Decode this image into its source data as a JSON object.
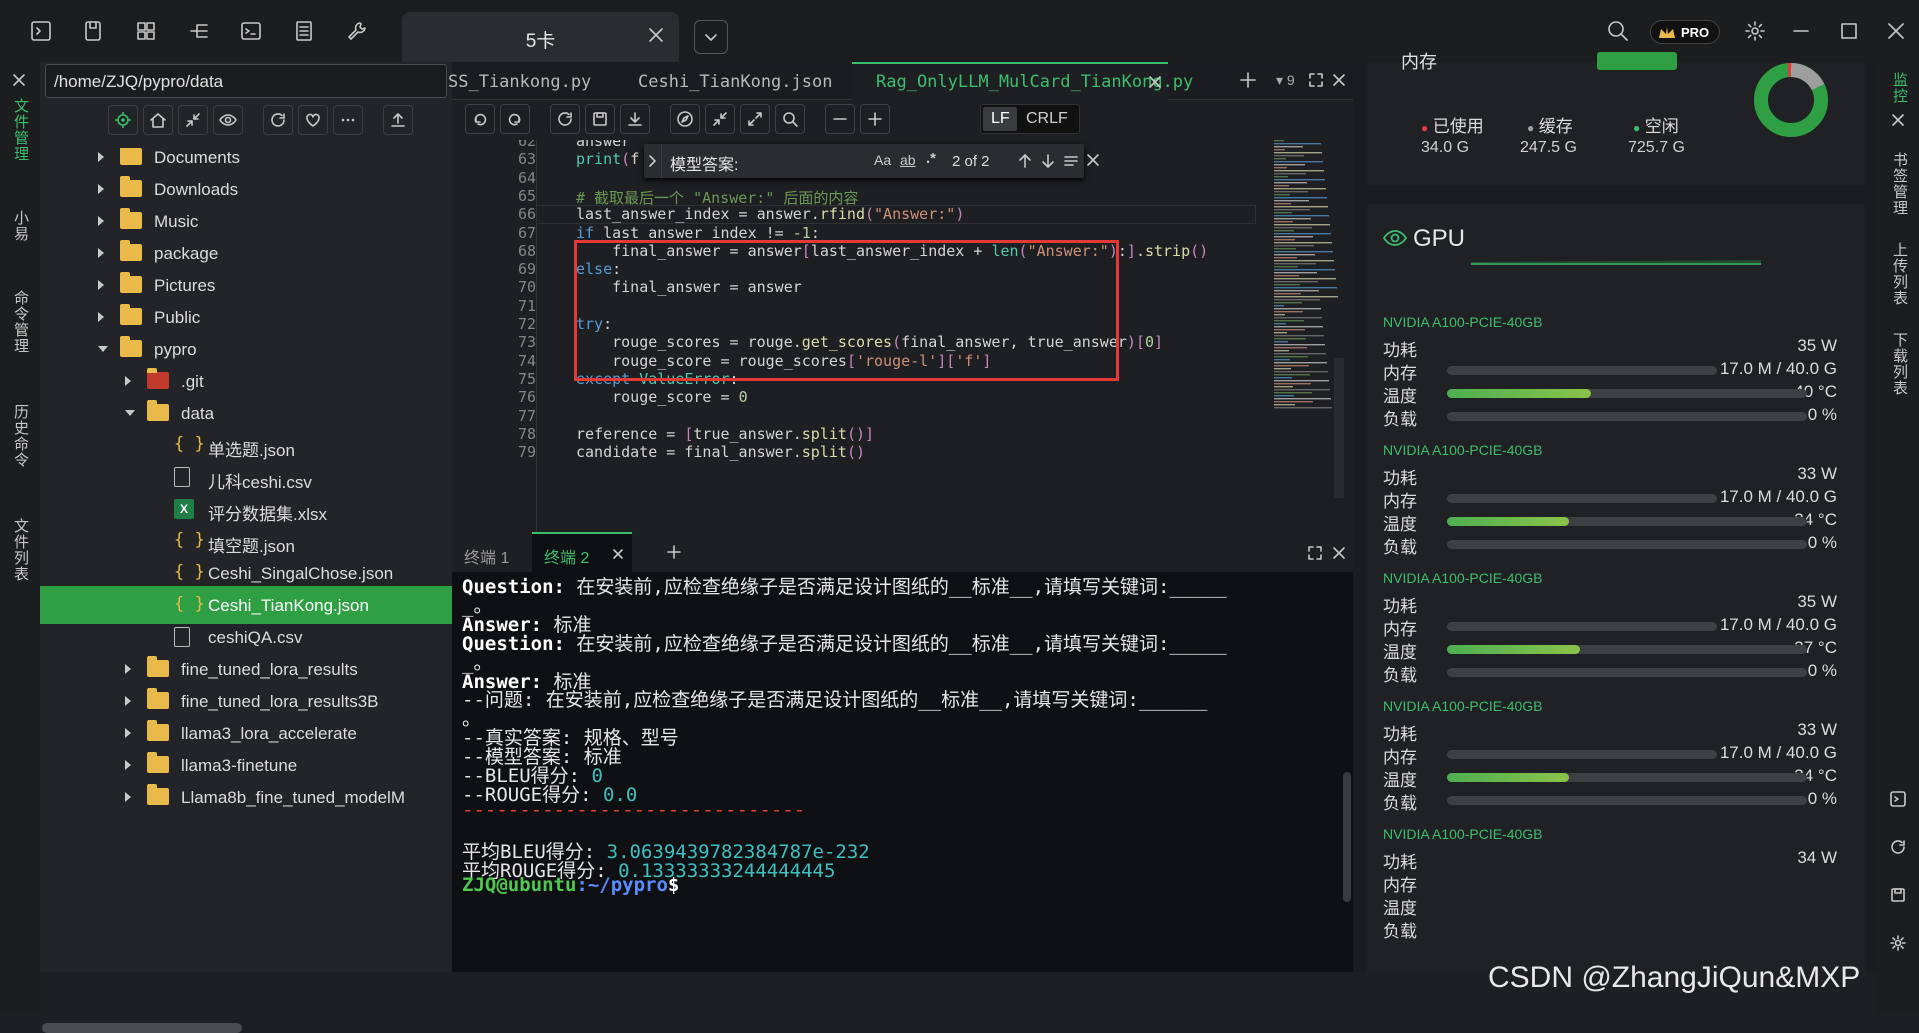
{
  "top_tab": {
    "label": "5卡"
  },
  "left_strip": [
    "文件管理",
    "小易",
    "命令管理",
    "历史命令",
    "文件列表"
  ],
  "right_strip": [
    "监控",
    "书签管理",
    "上传列表",
    "下载列表"
  ],
  "file_panel": {
    "path": "/home/ZJQ/pypro/data",
    "tree": [
      {
        "label": "Documents",
        "type": "folder",
        "depth": 0,
        "arrow": "right"
      },
      {
        "label": "Downloads",
        "type": "folder",
        "depth": 0,
        "arrow": "right"
      },
      {
        "label": "Music",
        "type": "folder",
        "depth": 0,
        "arrow": "right"
      },
      {
        "label": "package",
        "type": "folder",
        "depth": 0,
        "arrow": "right"
      },
      {
        "label": "Pictures",
        "type": "folder",
        "depth": 0,
        "arrow": "right"
      },
      {
        "label": "Public",
        "type": "folder",
        "depth": 0,
        "arrow": "right"
      },
      {
        "label": "pypro",
        "type": "folder",
        "depth": 0,
        "arrow": "down"
      },
      {
        "label": ".git",
        "type": "folder",
        "depth": 1,
        "arrow": "right"
      },
      {
        "label": "data",
        "type": "folder",
        "depth": 1,
        "arrow": "down"
      },
      {
        "label": "单选题.json",
        "type": "json",
        "depth": 2
      },
      {
        "label": "儿科ceshi.csv",
        "type": "doc",
        "depth": 2
      },
      {
        "label": "评分数据集.xlsx",
        "type": "xlsx",
        "depth": 2
      },
      {
        "label": "填空题.json",
        "type": "json",
        "depth": 2
      },
      {
        "label": "Ceshi_SingalChose.json",
        "type": "json",
        "depth": 2
      },
      {
        "label": "Ceshi_TianKong.json",
        "type": "json",
        "depth": 2,
        "selected": true
      },
      {
        "label": "ceshiQA.csv",
        "type": "doc",
        "depth": 2
      },
      {
        "label": "fine_tuned_lora_results",
        "type": "folder",
        "depth": 1,
        "arrow": "right"
      },
      {
        "label": "fine_tuned_lora_results3B",
        "type": "folder",
        "depth": 1,
        "arrow": "right"
      },
      {
        "label": "llama3_lora_accelerate",
        "type": "folder",
        "depth": 1,
        "arrow": "right"
      },
      {
        "label": "llama3-finetune",
        "type": "folder",
        "depth": 1,
        "arrow": "right"
      },
      {
        "label": "Llama8b_fine_tuned_modelM",
        "type": "folder",
        "depth": 1,
        "arrow": "right"
      }
    ]
  },
  "editor": {
    "tabs": [
      {
        "label": "SS_Tiankong.py"
      },
      {
        "label": "Ceshi_TianKong.json"
      },
      {
        "label": "Rag_OnlyLLM_MulCard_TianKong.py",
        "active": true
      }
    ],
    "tab_count": "9",
    "lf": "LF",
    "crlf": "CRLF",
    "find": {
      "query": "模型答案:",
      "case": "Aa",
      "word": "ab",
      "regex": ".*",
      "result": "2 of 2"
    },
    "lines": [
      {
        "n": "62",
        "code": "answer"
      },
      {
        "n": "63",
        "code": "print(f"
      },
      {
        "n": "64",
        "code": ""
      },
      {
        "n": "65",
        "code": "# 截取最后一个 \"Answer:\" 后面的内容"
      },
      {
        "n": "66",
        "code": "last_answer_index = answer.rfind(\"Answer:\")"
      },
      {
        "n": "67",
        "code": "if last_answer_index != -1:"
      },
      {
        "n": "68",
        "code": "    final_answer = answer[last_answer_index + len(\"Answer:\"):].strip()"
      },
      {
        "n": "69",
        "code": "else:"
      },
      {
        "n": "70",
        "code": "    final_answer = answer"
      },
      {
        "n": "71",
        "code": ""
      },
      {
        "n": "72",
        "code": "try:"
      },
      {
        "n": "73",
        "code": "    rouge_scores = rouge.get_scores(final_answer, true_answer)[0]"
      },
      {
        "n": "74",
        "code": "    rouge_score = rouge_scores['rouge-l']['f']"
      },
      {
        "n": "75",
        "code": "except ValueError:"
      },
      {
        "n": "76",
        "code": "    rouge_score = 0"
      },
      {
        "n": "77",
        "code": ""
      },
      {
        "n": "78",
        "code": "reference = [true_answer.split()]"
      },
      {
        "n": "79",
        "code": "candidate = final_answer.split()"
      }
    ]
  },
  "terminal": {
    "tabs": [
      {
        "label": "终端 1"
      },
      {
        "label": "终端 2",
        "active": true
      }
    ],
    "lines": [
      {
        "k": "Question:",
        "v": " 在安装前,应检查绝缘子是否满足设计图纸的__标准__,请填写关键词:_____"
      },
      {
        "k": "",
        "v": "_。"
      },
      {
        "k": "Answer:",
        "v": " 标准"
      },
      {
        "k": "Question:",
        "v": " 在安装前,应检查绝缘子是否满足设计图纸的__标准__,请填写关键词:_____"
      },
      {
        "k": "",
        "v": "_。"
      },
      {
        "k": "Answer:",
        "v": " 标准"
      },
      {
        "k": "",
        "v": "--问题: 在安装前,应检查绝缘子是否满足设计图纸的__标准__,请填写关键词:______"
      },
      {
        "k": "",
        "v": "。"
      },
      {
        "k": "",
        "v": "--真实答案: 规格、型号"
      },
      {
        "k": "",
        "v": "--模型答案: 标准"
      },
      {
        "k": "",
        "v": "--BLEU得分: ",
        "num": "0"
      },
      {
        "k": "",
        "v": "--ROUGE得分: ",
        "num": "0.0"
      },
      {
        "k": "",
        "v": "------------------------------",
        "red": true
      },
      {
        "k": "",
        "v": ""
      },
      {
        "k": "",
        "v": "平均BLEU得分: ",
        "num": "3.0639439782384787e-232"
      },
      {
        "k": "",
        "v": "平均ROUGE得分: ",
        "num": "0.13333333244444445"
      }
    ],
    "prompt_user": "ZJQ@ubuntu",
    "prompt_path": ":~/pypro",
    "prompt_end": "$"
  },
  "monitor": {
    "memory_title": "内存",
    "used_label": "已使用",
    "used_value": "34.0 G",
    "cache_label": "缓存",
    "cache_value": "247.5 G",
    "free_label": "空闲",
    "free_value": "725.7 G",
    "gpu_title": "GPU",
    "labels": {
      "power": "功耗",
      "mem": "内存",
      "temp": "温度",
      "load": "负载"
    },
    "gpus": [
      {
        "name": "NVIDIA A100-PCIE-40GB",
        "power": "35 W",
        "mem": "17.0 M / 40.0 G",
        "temp": "40 °C",
        "load": "0 %",
        "temp_frac": 0.4
      },
      {
        "name": "NVIDIA A100-PCIE-40GB",
        "power": "33 W",
        "mem": "17.0 M / 40.0 G",
        "temp": "34 °C",
        "load": "0 %",
        "temp_frac": 0.34
      },
      {
        "name": "NVIDIA A100-PCIE-40GB",
        "power": "35 W",
        "mem": "17.0 M / 40.0 G",
        "temp": "37 °C",
        "load": "0 %",
        "temp_frac": 0.37
      },
      {
        "name": "NVIDIA A100-PCIE-40GB",
        "power": "33 W",
        "mem": "17.0 M / 40.0 G",
        "temp": "34 °C",
        "load": "0 %",
        "temp_frac": 0.34
      },
      {
        "name": "NVIDIA A100-PCIE-40GB",
        "power": "34 W",
        "mem": "",
        "temp": "",
        "load": "",
        "temp_frac": 0
      }
    ]
  },
  "pro_badge": "PRO",
  "watermark": "CSDN @ZhangJiQun&MXP"
}
